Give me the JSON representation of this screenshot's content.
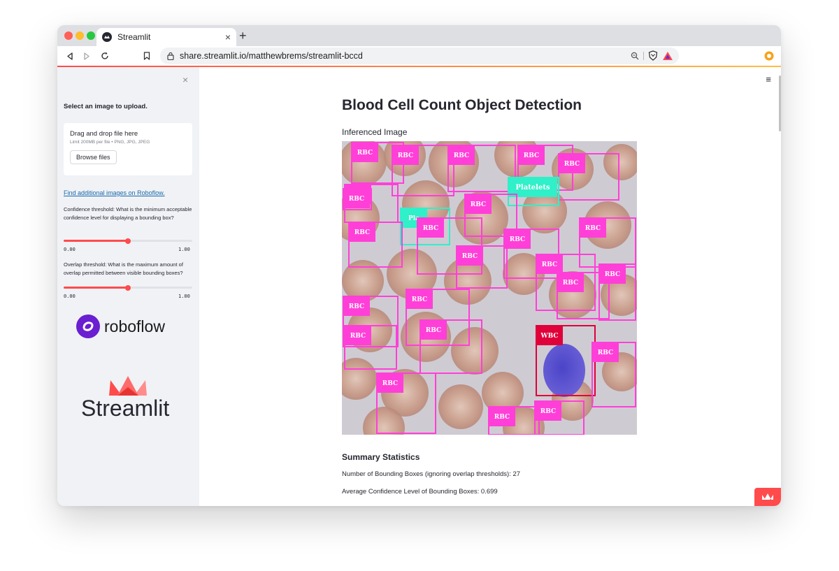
{
  "browser": {
    "tab_title": "Streamlit",
    "tab_close": "×",
    "new_tab": "+",
    "url": "share.streamlit.io/matthewbrems/streamlit-bccd"
  },
  "sidebar": {
    "close": "×",
    "upload_heading": "Select an image to upload.",
    "uploader": {
      "title": "Drag and drop file here",
      "hint": "Limit 200MB per file • PNG, JPG, JPEG",
      "button": "Browse files"
    },
    "roboflow_link": "Find additional images on Roboflow.",
    "confidence_slider": {
      "label": "Confidence threshold: What is the minimum acceptable confidence level for displaying a bounding box?",
      "min": "0.00",
      "max": "1.00",
      "value": 0.5
    },
    "overlap_slider": {
      "label": "Overlap threshold: What is the maximum amount of overlap permitted between visible bounding boxes?",
      "min": "0.00",
      "max": "1.00",
      "value": 0.5
    },
    "roboflow_logo_text": "roboflow",
    "streamlit_logo_text": "Streamlit"
  },
  "main": {
    "menu_icon": "≡",
    "title": "Blood Cell Count Object Detection",
    "image_heading": "Inferenced Image",
    "stats_title": "Summary Statistics",
    "stat_boxes": "Number of Bounding Boxes (ignoring overlap thresholds): 27",
    "stat_confidence": "Average Confidence Level of Bounding Boxes: 0.699"
  },
  "colors": {
    "accent": "#ff4b4b",
    "rbc_box": "#ff3fd8",
    "platelet_box": "#2ff0c8",
    "wbc_box": "#e0003a"
  },
  "detections": [
    {
      "label": "RBC"
    },
    {
      "label": "RBC"
    },
    {
      "label": "RBC"
    },
    {
      "label": "RBC"
    },
    {
      "label": "RBC"
    },
    {
      "label": "Platelets"
    },
    {
      "label": "RBC"
    },
    {
      "label": "Pla"
    },
    {
      "label": "RBC"
    },
    {
      "label": "RBC"
    },
    {
      "label": "RBC"
    },
    {
      "label": "RBC"
    },
    {
      "label": "RBC"
    },
    {
      "label": "RBC"
    },
    {
      "label": "RBC"
    },
    {
      "label": "RBC"
    },
    {
      "label": "RBC"
    },
    {
      "label": "RBC"
    },
    {
      "label": "RBC"
    },
    {
      "label": "RBC"
    },
    {
      "label": "RBC"
    },
    {
      "label": "WBC"
    },
    {
      "label": "RBC"
    },
    {
      "label": "RBC"
    },
    {
      "label": "RBC"
    },
    {
      "label": "RBC"
    },
    {
      "label": "RBC"
    }
  ]
}
